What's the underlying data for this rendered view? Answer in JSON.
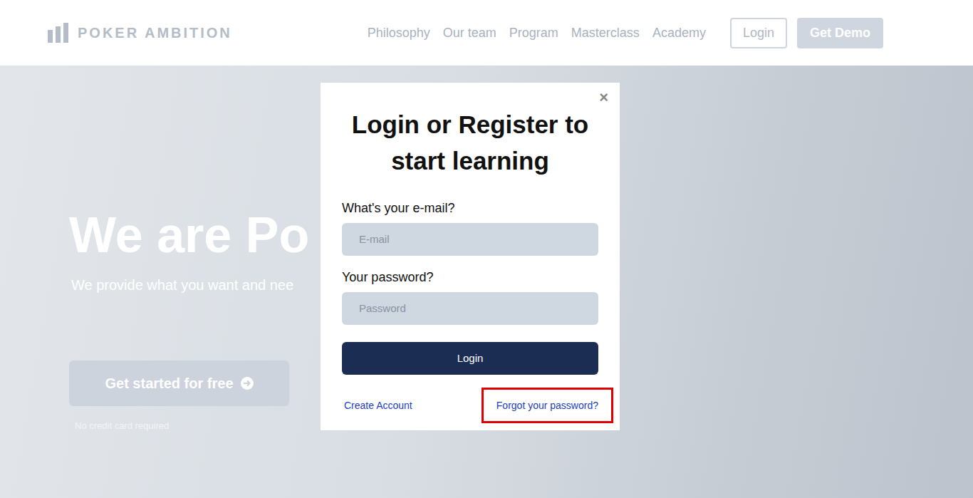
{
  "header": {
    "logo": "POKER AMBITION",
    "nav": [
      "Philosophy",
      "Our team",
      "Program",
      "Masterclass",
      "Academy"
    ],
    "login": "Login",
    "demo": "Get Demo"
  },
  "hero": {
    "title": "We are Po",
    "subtitle": "We provide what you want and nee",
    "cta": "Get started for free",
    "note": "No credit card required"
  },
  "modal": {
    "close": "×",
    "title": "Login or Register to start learning",
    "email_label": "What's your e-mail?",
    "email_placeholder": "E-mail",
    "password_label": "Your password?",
    "password_placeholder": "Password",
    "submit": "Login",
    "links": [
      {
        "label": "Create Account",
        "highlighted": false
      },
      {
        "label": "Forgot your password?",
        "highlighted": true
      }
    ]
  }
}
